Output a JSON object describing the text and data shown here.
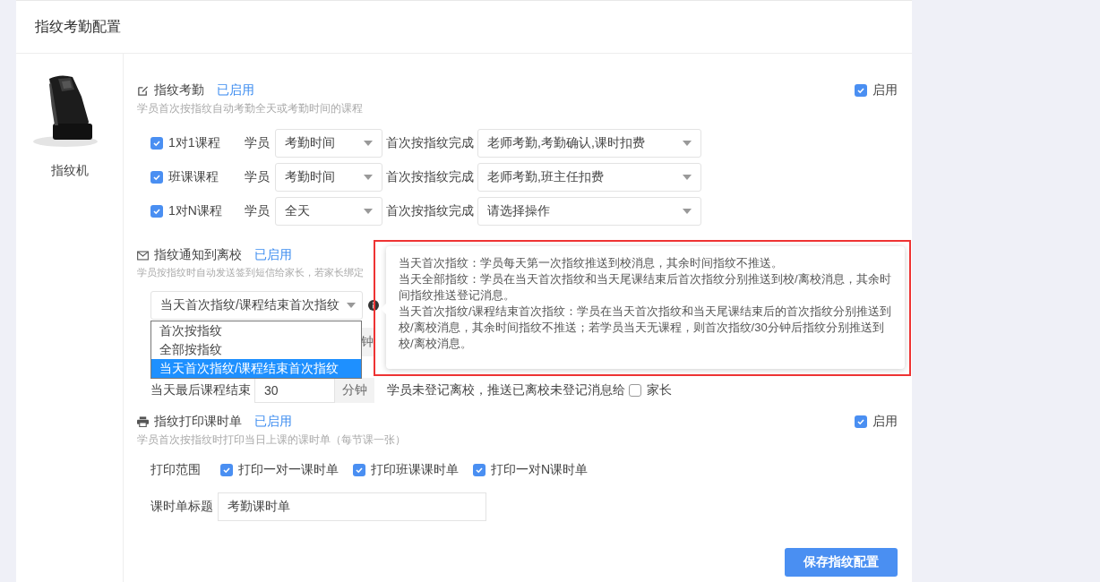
{
  "title": "指纹考勤配置",
  "device": {
    "kind": "picture",
    "label": "指纹机"
  },
  "attendance": {
    "title": "指纹考勤",
    "status": "已启用",
    "description": "学员首次按指纹自动考勤全天或考勤时间的课程",
    "enable": {
      "label": "启用",
      "checked": true
    },
    "courses": [
      {
        "label": "1对1课程",
        "checked": true,
        "who": "学员",
        "scope": "考勤时间",
        "action_label": "首次按指纹完成",
        "action": "老师考勤,考勤确认,课时扣费"
      },
      {
        "label": "班课课程",
        "checked": true,
        "who": "学员",
        "scope": "考勤时间",
        "action_label": "首次按指纹完成",
        "action": "老师考勤,班主任扣费"
      },
      {
        "label": "1对N课程",
        "checked": true,
        "who": "学员",
        "scope": "全天",
        "action_label": "首次按指纹完成",
        "action": "请选择操作"
      }
    ]
  },
  "notify": {
    "title": "指纹通知到离校",
    "status": "已启用",
    "description": "学员按指纹时自动发送签到短信给家长，若家长绑定",
    "mode": "当天首次指纹/课程结束首次指纹",
    "options": [
      {
        "label": "首次按指纹",
        "selected": false
      },
      {
        "label": "全部按指纹",
        "selected": false
      },
      {
        "label": "当天首次指纹/课程结束首次指纹",
        "selected": true
      }
    ],
    "hidden_row": {
      "addon": "钟"
    },
    "last_row": {
      "label": "当天最后课程结束",
      "value": "30",
      "addon": "分钟",
      "text": "学员未登记离校，推送已离校未登记消息给",
      "checkbox": {
        "label": "家长",
        "checked": false
      }
    },
    "tooltip": [
      "当天首次指纹：学员每天第一次指纹推送到校消息，其余时间指纹不推送。",
      "当天全部指纹：学员在当天首次指纹和当天尾课结束后首次指纹分别推送到校/离校消息，其余时间指纹推送登记消息。",
      "当天首次指纹/课程结束首次指纹：学员在当天首次指纹和当天尾课结束后的首次指纹分别推送到校/离校消息，其余时间指纹不推送；若学员当天无课程，则首次指纹/30分钟后指纹分别推送到校/离校消息。"
    ]
  },
  "print": {
    "title": "指纹打印课时单",
    "status": "已启用",
    "description": "学员首次按指纹时打印当日上课的课时单（每节课一张）",
    "enable": {
      "label": "启用",
      "checked": true
    },
    "scope_label": "打印范围",
    "scopes": [
      {
        "label": "打印一对一课时单",
        "checked": true
      },
      {
        "label": "打印班课课时单",
        "checked": true
      },
      {
        "label": "打印一对N课时单",
        "checked": true
      }
    ],
    "title_field": {
      "label": "课时单标题",
      "value": "考勤课时单"
    }
  },
  "save": "保存指纹配置"
}
